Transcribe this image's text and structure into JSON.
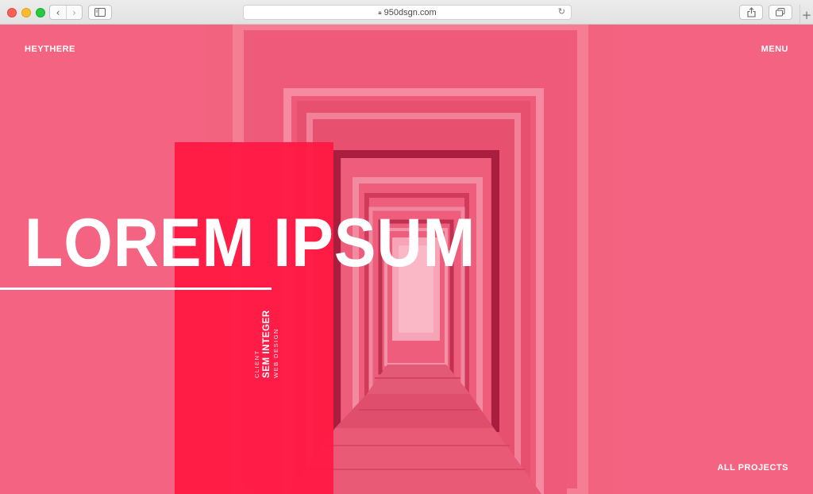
{
  "browser": {
    "url": "950dsgn.com",
    "back_icon": "chevron-left-icon",
    "forward_icon": "chevron-right-icon",
    "new_tab_glyph": "+"
  },
  "site": {
    "brand": "HEYTHERE",
    "menu": "MENU",
    "headline": "LOREM IPSUM",
    "client_label": "CLIENT",
    "client_name": "SEM INTEGER",
    "service": "WEB DESIGN",
    "all_projects": "ALL PROJECTS"
  },
  "colors": {
    "overlay_pink": "#f46482",
    "accent_red": "#ff1a44",
    "text": "#ffffff"
  }
}
